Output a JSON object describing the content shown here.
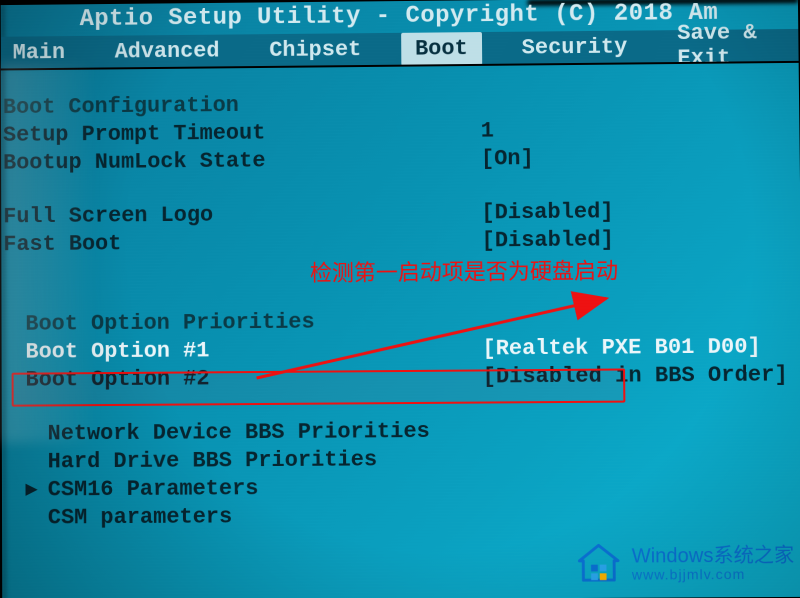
{
  "title": "Aptio Setup Utility - Copyright (C) 2018 Am",
  "menu": {
    "items": [
      "Main",
      "Advanced",
      "Chipset",
      "Boot",
      "Security",
      "Save & Exit"
    ],
    "active_index": 3
  },
  "page": {
    "header": "Boot Configuration",
    "rows": [
      {
        "label": "Setup Prompt Timeout",
        "value": "1"
      },
      {
        "label": "Bootup NumLock State",
        "value": "[On]"
      }
    ],
    "rows2": [
      {
        "label": "Full Screen Logo",
        "value": "[Disabled]"
      },
      {
        "label": "Fast Boot",
        "value": "[Disabled]"
      }
    ],
    "section2": "Boot Option Priorities",
    "boot_options": [
      {
        "label": "Boot Option #1",
        "value": "[Realtek PXE B01 D00]",
        "highlighted": true
      },
      {
        "label": "Boot Option #2",
        "value": "[Disabled in BBS Order]"
      }
    ],
    "submenus": [
      "Network Device BBS Priorities",
      "Hard Drive BBS Priorities",
      "CSM16 Parameters",
      "CSM parameters"
    ],
    "submenu_caret_index": 2
  },
  "annotation": {
    "text": "检测第一启动项是否为硬盘启动"
  },
  "watermark": {
    "title": "Windows系统之家",
    "url": "www.bjjmlv.com"
  }
}
